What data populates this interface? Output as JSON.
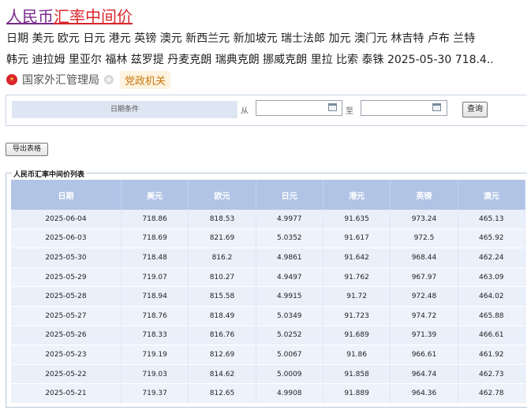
{
  "result": {
    "title_part1": "人民币",
    "title_part2": "汇率中间价",
    "snippet_line1": "日期 美元 欧元 日元 港元 英镑 澳元 新西兰元 新加坡元 瑞士法郎 加元 澳门元 林吉特 卢布 兰特",
    "snippet_line2": "韩元 迪拉姆 里亚尔 福林 兹罗提 丹麦克朗 瑞典克朗 挪威克朗 里拉 比索 泰铢 2025-05-30 718.4..",
    "source_name": "国家外汇管理局",
    "source_badge": "党政机关"
  },
  "filter": {
    "condition_label": "日期条件",
    "from_label": "从",
    "to_label": "至",
    "from_value": "",
    "to_value": "",
    "query_label": "查询"
  },
  "export_label": "导出表格",
  "table": {
    "caption": "人民币汇率中间价列表",
    "headers": [
      "日期",
      "美元",
      "欧元",
      "日元",
      "港元",
      "英镑",
      "澳元"
    ],
    "rows": [
      [
        "2025-06-04",
        "718.86",
        "818.53",
        "4.9977",
        "91.635",
        "973.24",
        "465.13"
      ],
      [
        "2025-06-03",
        "718.69",
        "821.69",
        "5.0352",
        "91.617",
        "972.5",
        "465.92"
      ],
      [
        "2025-05-30",
        "718.48",
        "816.2",
        "4.9861",
        "91.642",
        "968.44",
        "462.24"
      ],
      [
        "2025-05-29",
        "719.07",
        "810.27",
        "4.9497",
        "91.762",
        "967.97",
        "463.09"
      ],
      [
        "2025-05-28",
        "718.94",
        "815.58",
        "4.9915",
        "91.72",
        "972.48",
        "464.02"
      ],
      [
        "2025-05-27",
        "718.76",
        "818.49",
        "5.0349",
        "91.723",
        "974.72",
        "465.88"
      ],
      [
        "2025-05-26",
        "718.33",
        "816.76",
        "5.0252",
        "91.689",
        "971.39",
        "466.61"
      ],
      [
        "2025-05-23",
        "719.19",
        "812.69",
        "5.0067",
        "91.86",
        "966.61",
        "461.92"
      ],
      [
        "2025-05-22",
        "719.03",
        "814.62",
        "5.0009",
        "91.858",
        "964.74",
        "462.73"
      ],
      [
        "2025-05-21",
        "719.37",
        "812.65",
        "4.9908",
        "91.889",
        "964.36",
        "462.78"
      ]
    ]
  },
  "colors": {
    "title_purple": "#7a2a8c",
    "title_red": "#d9262c",
    "header_blue": "#b1c4e6",
    "row_blue": "#e9f0fa",
    "badge_orange": "#c8780d"
  }
}
